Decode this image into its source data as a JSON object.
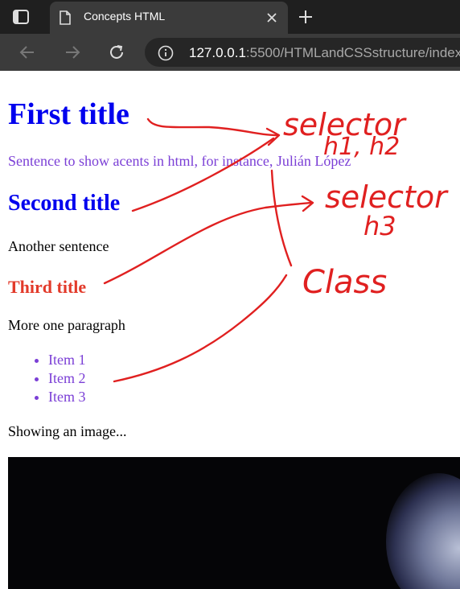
{
  "browser": {
    "tab_title": "Concepts HTML",
    "url_host": "127.0.0.1",
    "url_rest": ":5500/HTMLandCSSstructure/index"
  },
  "content": {
    "h1": "First title",
    "sentence": "Sentence to show acents in html, for instance, Julián López",
    "h2": "Second title",
    "sentence2": "Another sentence",
    "h3": "Third title",
    "paragraph": "More one paragraph",
    "items": [
      "Item 1",
      "Item 2",
      "Item 3"
    ],
    "image_caption": "Showing an image..."
  },
  "annotations": {
    "note1_line1": "selector",
    "note1_line2": "h1, h2",
    "note2_line1": "selector",
    "note2_line2": "h3",
    "note3": "Class"
  },
  "colors": {
    "heading_blue": "#0000ee",
    "accent_purple": "#7b3fd6",
    "h3_red": "#e23a2a",
    "annotation_red": "#e02020"
  },
  "icons": [
    "window-icon",
    "page-icon",
    "close-icon",
    "plus-icon",
    "back-icon",
    "forward-icon",
    "reload-icon",
    "info-icon"
  ]
}
